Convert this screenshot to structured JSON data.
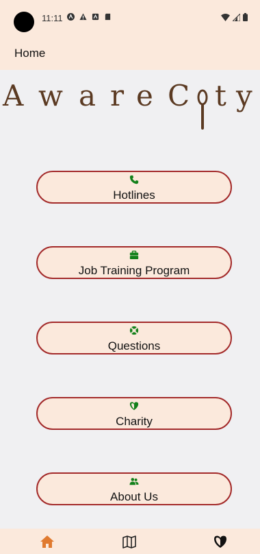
{
  "status_bar": {
    "time": "11:11",
    "icons": [
      "app-icon",
      "warning-icon",
      "notification-icon",
      "sd-card-icon"
    ],
    "right_icons": [
      "wifi-icon",
      "signal-icon",
      "battery-icon"
    ]
  },
  "app_bar": {
    "title": "Home"
  },
  "logo": {
    "text": "AwareCity"
  },
  "menu": [
    {
      "label": "Hotlines",
      "icon": "phone-icon",
      "color": "#12801a"
    },
    {
      "label": "Job Training Program",
      "icon": "briefcase-icon",
      "color": "#12801a"
    },
    {
      "label": "Questions",
      "icon": "lifebuoy-icon",
      "color": "#12801a"
    },
    {
      "label": "Charity",
      "icon": "heart-shield-icon",
      "color": "#12801a"
    },
    {
      "label": "About Us",
      "icon": "users-icon",
      "color": "#12801a"
    }
  ],
  "bottom_nav": [
    {
      "name": "home",
      "icon": "home-icon",
      "active": true
    },
    {
      "name": "map",
      "icon": "map-icon",
      "active": false
    },
    {
      "name": "charity",
      "icon": "heart-shield-icon",
      "active": false
    }
  ],
  "colors": {
    "accent": "#fbe9dc",
    "border": "#a32a2a",
    "icon_green": "#12801a",
    "home_active": "#e07a2f",
    "logo_brown": "#5b3a22"
  }
}
